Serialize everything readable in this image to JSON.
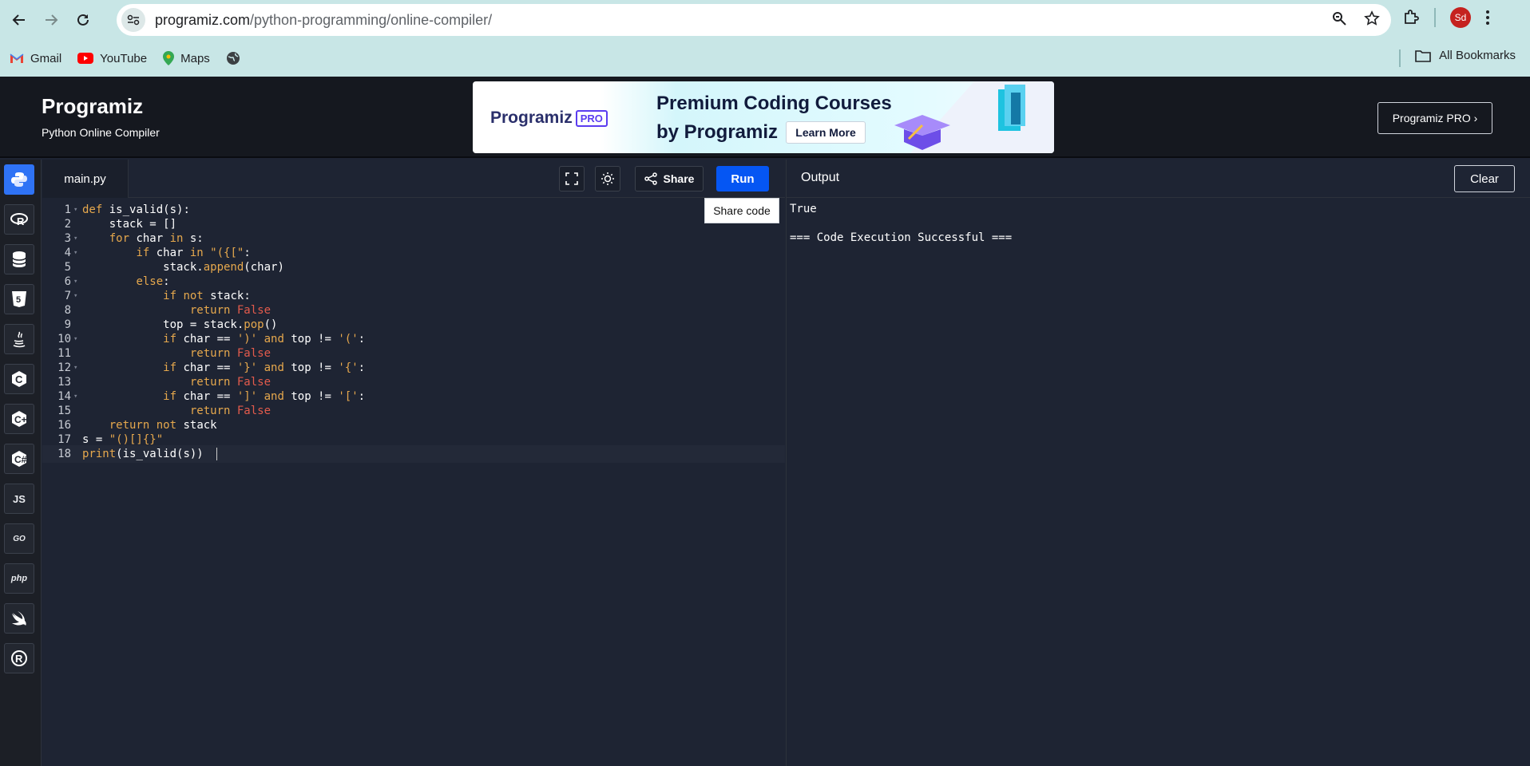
{
  "browser": {
    "url_domain": "programiz.com",
    "url_path": "/python-programming/online-compiler/",
    "profile_initials": "Sd",
    "bookmarks": [
      {
        "label": "Gmail",
        "icon": "gmail-icon"
      },
      {
        "label": "YouTube",
        "icon": "youtube-icon"
      },
      {
        "label": "Maps",
        "icon": "maps-icon"
      }
    ],
    "all_bookmarks": "All Bookmarks"
  },
  "site": {
    "logo": "Programiz",
    "subtitle": "Python Online Compiler",
    "ad": {
      "logo": "Programiz",
      "logo_badge": "PRO",
      "headline1": "Premium Coding Courses",
      "headline2": "by Programiz",
      "cta": "Learn More"
    },
    "pro_button": "Programiz PRO ›"
  },
  "rail": {
    "items": [
      {
        "label": "",
        "icon": "python-icon",
        "active": true
      },
      {
        "label": "",
        "icon": "r-icon"
      },
      {
        "label": "",
        "icon": "database-icon"
      },
      {
        "label": "",
        "icon": "html5-icon"
      },
      {
        "label": "",
        "icon": "java-icon"
      },
      {
        "label": "",
        "icon": "c-icon"
      },
      {
        "label": "",
        "icon": "cpp-icon"
      },
      {
        "label": "",
        "icon": "csharp-icon"
      },
      {
        "label": "JS",
        "icon": "javascript-icon"
      },
      {
        "label": "GO",
        "icon": "go-icon"
      },
      {
        "label": "php",
        "icon": "php-icon"
      },
      {
        "label": "",
        "icon": "swift-icon"
      },
      {
        "label": "",
        "icon": "rust-icon"
      }
    ]
  },
  "editor": {
    "filename": "main.py",
    "share_label": "Share",
    "run_label": "Run",
    "tooltip": "Share code",
    "lines": [
      "def is_valid(s):",
      "    stack = []",
      "    for char in s:",
      "        if char in \"({[\":",
      "            stack.append(char)",
      "        else:",
      "            if not stack:",
      "                return False",
      "            top = stack.pop()",
      "            if char == ')' and top != '(':",
      "                return False",
      "            if char == '}' and top != '{':",
      "                return False",
      "            if char == ']' and top != '[':",
      "                return False",
      "    return not stack",
      "s = \"()[]{}\"",
      "print(is_valid(s))"
    ],
    "line_numbers": [
      "1",
      "2",
      "3",
      "4",
      "5",
      "6",
      "7",
      "8",
      "9",
      "10",
      "11",
      "12",
      "13",
      "14",
      "15",
      "16",
      "17",
      "18"
    ]
  },
  "output": {
    "title": "Output",
    "clear_label": "Clear",
    "lines": [
      "True",
      "",
      "=== Code Execution Successful ==="
    ]
  }
}
